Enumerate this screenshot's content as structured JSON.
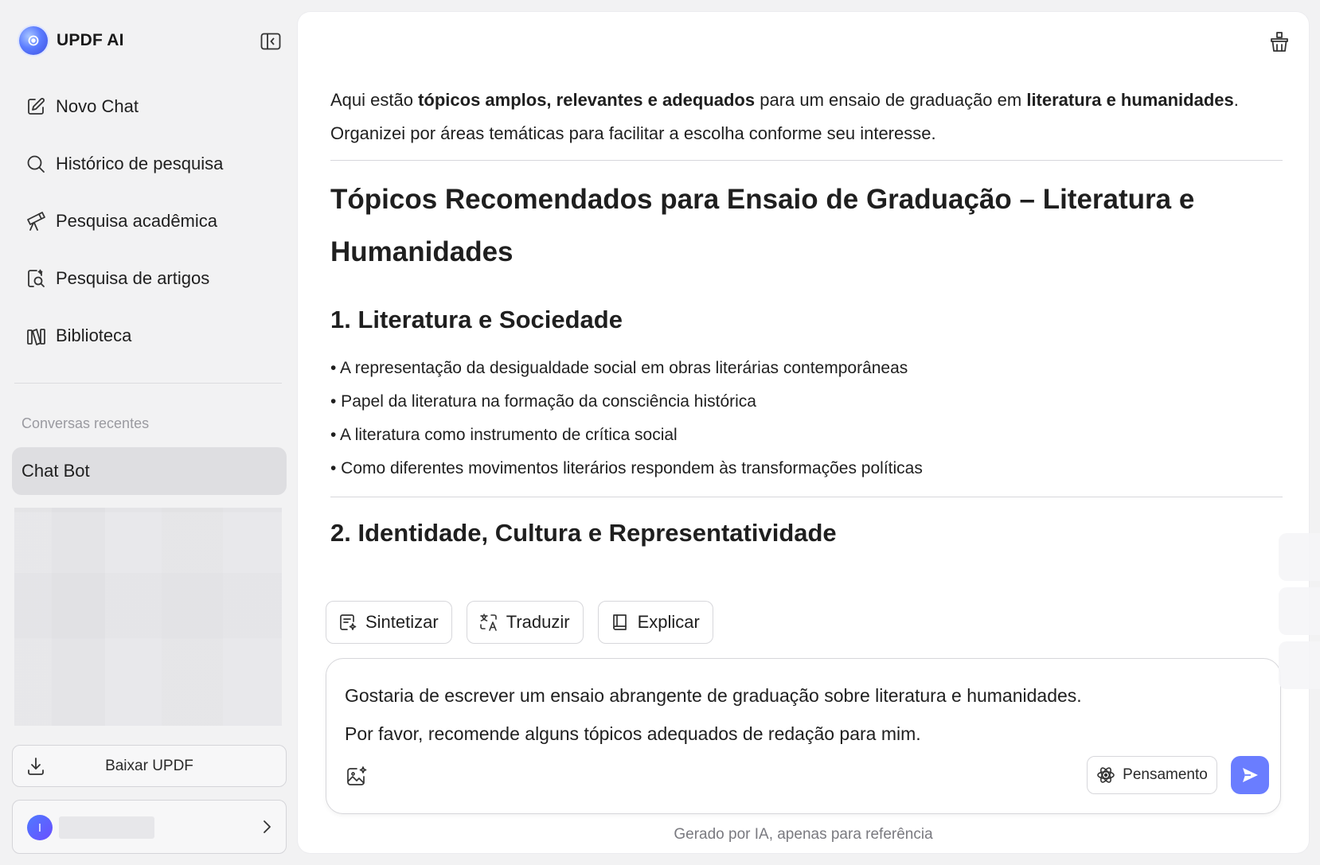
{
  "app": {
    "title": "UPDF AI"
  },
  "sidebar": {
    "items": [
      {
        "label": "Novo Chat",
        "icon": "edit-icon"
      },
      {
        "label": "Histórico de pesquisa",
        "icon": "search-icon"
      },
      {
        "label": "Pesquisa acadêmica",
        "icon": "telescope-icon"
      },
      {
        "label": "Pesquisa de artigos",
        "icon": "document-search-icon"
      },
      {
        "label": "Biblioteca",
        "icon": "library-icon"
      }
    ],
    "recent_label": "Conversas recentes",
    "recent_chats": [
      {
        "label": "Chat Bot",
        "selected": true
      }
    ],
    "download_label": "Baixar UPDF",
    "account": {
      "avatar_initial": "I"
    }
  },
  "response": {
    "intro_parts": [
      {
        "text": "Aqui estão ",
        "bold": false
      },
      {
        "text": "tópicos amplos, relevantes e adequados",
        "bold": true
      },
      {
        "text": " para um ensaio de graduação em ",
        "bold": false
      },
      {
        "text": "literatura e humanidades",
        "bold": true
      },
      {
        "text": ".",
        "bold": false
      }
    ],
    "intro_line2": "Organizei por áreas temáticas para facilitar a escolha conforme seu interesse.",
    "heading": "Tópicos Recomendados para Ensaio de Graduação – Literatura e Humanidades",
    "section1": {
      "title": "1. Literatura e Sociedade",
      "bullets": [
        "• A representação da desigualdade social em obras literárias contemporâneas",
        "• Papel da literatura na formação da consciência histórica",
        "• A literatura como instrumento de crítica social",
        "• Como diferentes movimentos literários respondem às transformações políticas"
      ]
    },
    "section2": {
      "title": "2. Identidade, Cultura e Representatividade"
    }
  },
  "quick_actions": [
    {
      "label": "Sintetizar",
      "icon": "summarize-icon"
    },
    {
      "label": "Traduzir",
      "icon": "translate-icon"
    },
    {
      "label": "Explicar",
      "icon": "book-icon"
    }
  ],
  "input": {
    "line1": "Gostaria de escrever um ensaio abrangente de graduação sobre literatura e humanidades.",
    "line2": "Por favor, recomende alguns tópicos adequados de redação para mim.",
    "thinking_label": "Pensamento"
  },
  "footnote": "Gerado por IA, apenas para referência",
  "colors": {
    "accent": "#6a7dff",
    "selected_chat_bg": "#dedee1",
    "sidebar_bg": "#f2f2f3"
  }
}
